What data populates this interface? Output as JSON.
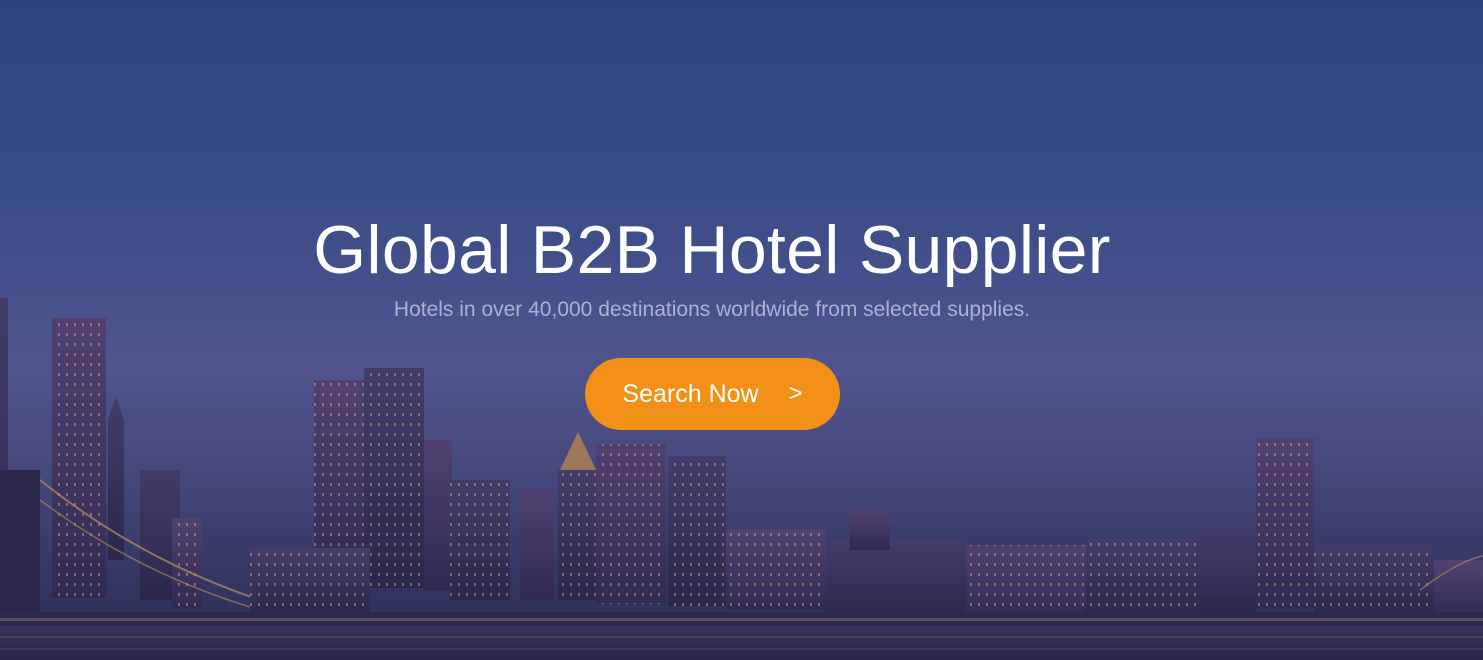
{
  "hero": {
    "title": "Global B2B Hotel Supplier",
    "subtitle": "Hotels in over 40,000 destinations worldwide from selected supplies.",
    "cta_label": "Search Now",
    "cta_arrow": ">"
  },
  "colors": {
    "accent": "#f39018",
    "sky_top": "#30467f",
    "subtitle_text": "#a9b2d3"
  },
  "background": {
    "description_icon": "city-skyline-night"
  }
}
